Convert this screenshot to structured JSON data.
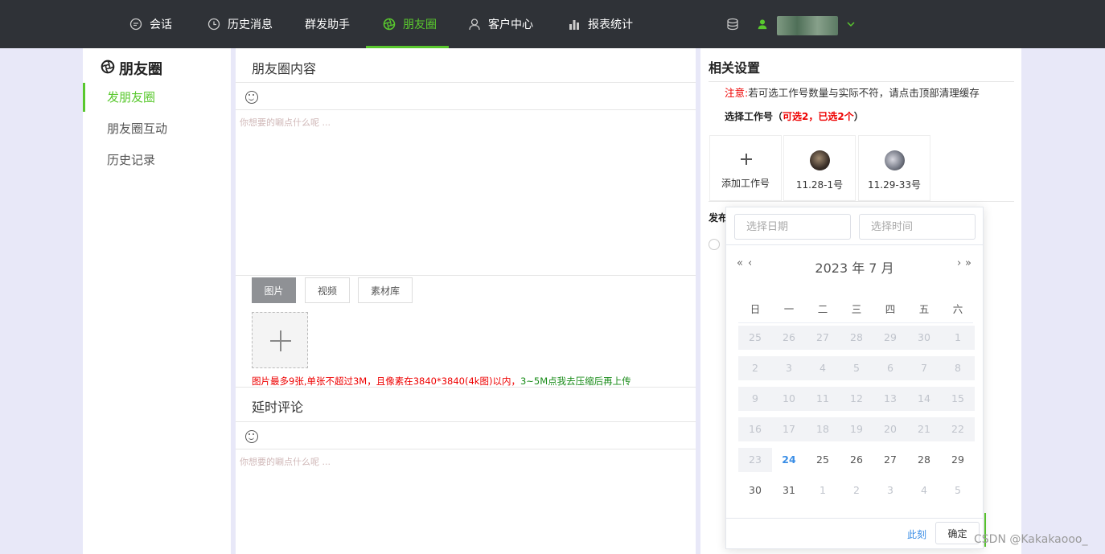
{
  "nav": {
    "items": [
      {
        "label": "会话",
        "icon": "chat-icon"
      },
      {
        "label": "历史消息",
        "icon": "clock-icon"
      },
      {
        "label": "群发助手",
        "icon": ""
      },
      {
        "label": "朋友圈",
        "icon": "moments-icon",
        "active": true
      },
      {
        "label": "客户中心",
        "icon": "user-icon"
      },
      {
        "label": "报表统计",
        "icon": "bar-chart-icon"
      }
    ],
    "accent_color": "#59c82e"
  },
  "sidebar": {
    "title": "朋友圈",
    "items": [
      {
        "label": "发朋友圈",
        "active": true
      },
      {
        "label": "朋友圈互动"
      },
      {
        "label": "历史记录"
      }
    ]
  },
  "content": {
    "section_title": "朋友圈内容",
    "placeholder": "你想要的唰点什么呢 ...",
    "media_tabs": [
      "图片",
      "视频",
      "素材库"
    ],
    "upload_note": "图片最多9张,单张不超过3M，且像素在3840*3840(4k图)以内，",
    "upload_link": "3~5M点我去压缩后再上传",
    "delay_title": "延时评论",
    "delay_placeholder": "你想要的唰点什么呢 ..."
  },
  "settings": {
    "title": "相关设置",
    "notice_prefix": "注意:",
    "notice_text": "若可选工作号数量与实际不符，请点击顶部清理缓存",
    "select_label": "选择工作号（",
    "select_count": "可选2，已选2个",
    "select_suffix": "）",
    "accounts": [
      "添加工作号",
      "11.28-1号",
      "11.29-33号"
    ],
    "publish_label": "发布"
  },
  "datepicker": {
    "date_placeholder": "选择日期",
    "time_placeholder": "选择时间",
    "header": "2023 年  7 月",
    "weekdays": [
      "日",
      "一",
      "二",
      "三",
      "四",
      "五",
      "六"
    ],
    "weeks": [
      [
        "25",
        "26",
        "27",
        "28",
        "29",
        "30",
        "1"
      ],
      [
        "2",
        "3",
        "4",
        "5",
        "6",
        "7",
        "8"
      ],
      [
        "9",
        "10",
        "11",
        "12",
        "13",
        "14",
        "15"
      ],
      [
        "16",
        "17",
        "18",
        "19",
        "20",
        "21",
        "22"
      ],
      [
        "23",
        "24",
        "25",
        "26",
        "27",
        "28",
        "29"
      ],
      [
        "30",
        "31",
        "1",
        "2",
        "3",
        "4",
        "5"
      ]
    ],
    "today": "24",
    "now_label": "此刻",
    "ok_label": "确定"
  },
  "watermark": "CSDN @Kakakaooo_"
}
